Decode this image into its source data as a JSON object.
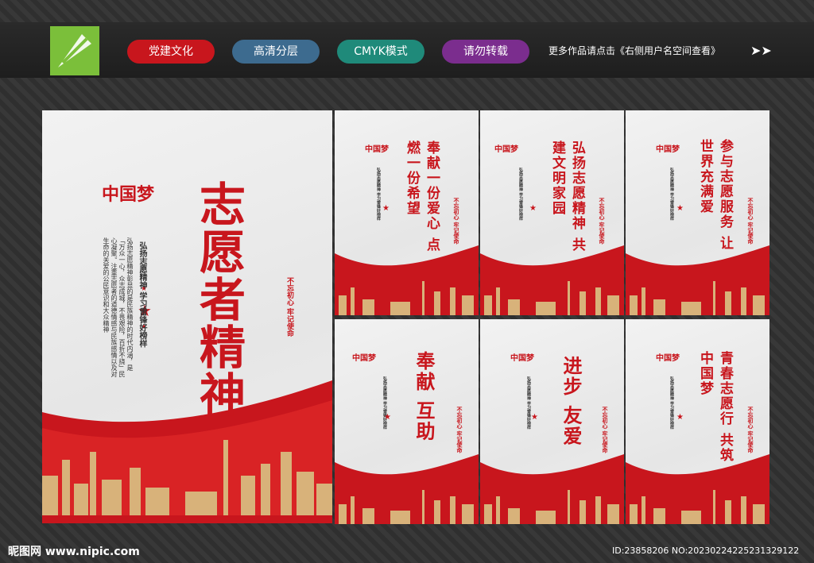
{
  "top_tags": [
    {
      "label": "党建文化",
      "color": "#c8161d"
    },
    {
      "label": "高清分层",
      "color": "#3d6b8f"
    },
    {
      "label": "CMYK模式",
      "color": "#1f8a7a"
    },
    {
      "label": "请勿转载",
      "color": "#7b2d8e"
    }
  ],
  "more_text": "更多作品请点击《右侧用户名空间查看》",
  "watermark": "昵图网 www.nipic.com",
  "id_text": "ID:23858206 NO:20230224225231329122",
  "main_panel": {
    "title": "志愿者精神",
    "subtitle": "弘扬志愿精神 学习雷锋好榜样",
    "body": "弘扬志愿精神彰显的是民族精神的时代内涵，是「万众一心，众志成城，不畏艰险，百折不挠」民心凝聚。注重志愿者的道德情感与民族感情以及对生命的关爱的公民意识和大众精神",
    "badge": "不忘初心 牢记使命"
  },
  "small_panels": [
    {
      "title": "奉献一份爱心 点燃一份希望"
    },
    {
      "title": "弘扬志愿精神 共建文明家园"
    },
    {
      "title": "参与志愿服务 让世界充满爱"
    },
    {
      "title": "奉献 互助"
    },
    {
      "title": "进步 友爱"
    },
    {
      "title": "青春志愿行 共筑中国梦"
    }
  ],
  "small_badge": "不忘初心 牢记使命",
  "small_subtitle": "弘扬志愿精神 学习雷锋好榜样"
}
